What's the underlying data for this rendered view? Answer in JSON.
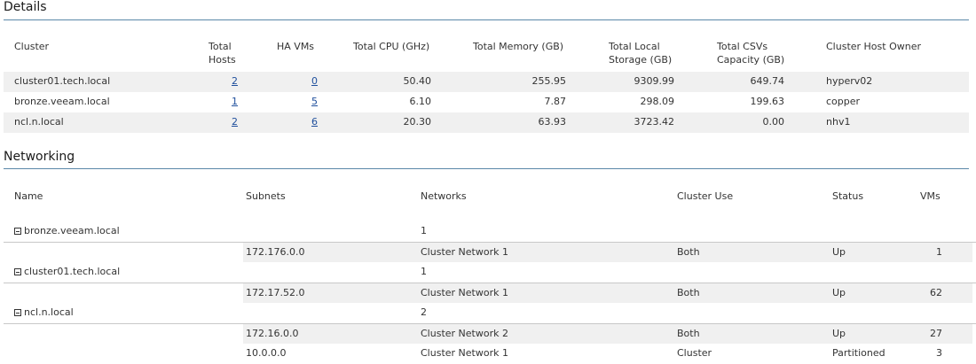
{
  "details": {
    "title": "Details",
    "headers": {
      "cluster": "Cluster",
      "total_hosts_1": "Total",
      "total_hosts_2": "Hosts",
      "ha_vms": "HA VMs",
      "total_cpu": "Total CPU (GHz)",
      "total_memory": "Total Memory (GB)",
      "local_storage_1": "Total Local",
      "local_storage_2": "Storage (GB)",
      "csvs_1": "Total CSVs",
      "csvs_2": "Capacity (GB)",
      "owner": "Cluster Host Owner"
    },
    "rows": [
      {
        "cluster": "cluster01.tech.local",
        "hosts": "2",
        "ha_vms": "0",
        "cpu": "50.40",
        "memory": "255.95",
        "storage": "9309.99",
        "csvs": "649.74",
        "owner": "hyperv02"
      },
      {
        "cluster": "bronze.veeam.local",
        "hosts": "1",
        "ha_vms": "5",
        "cpu": "6.10",
        "memory": "7.87",
        "storage": "298.09",
        "csvs": "199.63",
        "owner": "copper"
      },
      {
        "cluster": "ncl.n.local",
        "hosts": "2",
        "ha_vms": "6",
        "cpu": "20.30",
        "memory": "63.93",
        "storage": "3723.42",
        "csvs": "0.00",
        "owner": "nhv1"
      }
    ]
  },
  "networking": {
    "title": "Networking",
    "headers": {
      "name": "Name",
      "subnets": "Subnets",
      "networks": "Networks",
      "cluster_use": "Cluster Use",
      "status": "Status",
      "vms": "VMs"
    },
    "groups": [
      {
        "name": "bronze.veeam.local",
        "networks": "1",
        "rows": [
          {
            "subnet": "172.176.0.0",
            "network": "Cluster Network 1",
            "use": "Both",
            "status": "Up",
            "vms": "1"
          }
        ]
      },
      {
        "name": "cluster01.tech.local",
        "networks": "1",
        "rows": [
          {
            "subnet": "172.17.52.0",
            "network": "Cluster Network 1",
            "use": "Both",
            "status": "Up",
            "vms": "62"
          }
        ]
      },
      {
        "name": "ncl.n.local",
        "networks": "2",
        "rows": [
          {
            "subnet": "172.16.0.0",
            "network": "Cluster Network 2",
            "use": "Both",
            "status": "Up",
            "vms": "27"
          },
          {
            "subnet": "10.0.0.0",
            "network": "Cluster Network 1",
            "use": "Cluster",
            "status": "Partitioned",
            "vms": "3"
          }
        ]
      }
    ]
  }
}
